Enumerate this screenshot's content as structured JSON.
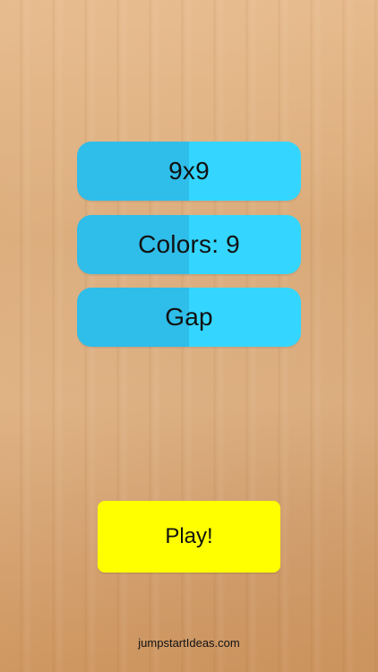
{
  "menu": {
    "options": [
      {
        "label": "9x9"
      },
      {
        "label": "Colors: 9"
      },
      {
        "label": "Gap"
      }
    ],
    "play": {
      "label": "Play!"
    }
  },
  "footer": {
    "link_text": "jumpstartIdeas.com"
  },
  "colors": {
    "option_left": "#2fbde9",
    "option_right": "#34d6ff",
    "play": "#ffff00"
  }
}
